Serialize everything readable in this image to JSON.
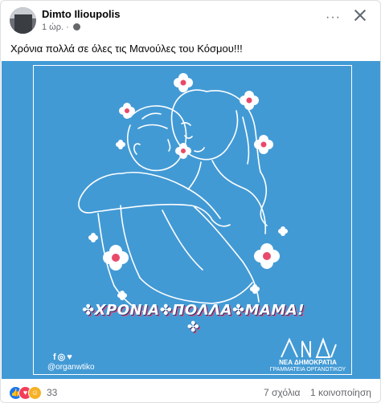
{
  "post": {
    "author": "Dimto Ilioupolis",
    "timestamp": "1 ώρ. ·",
    "privacy_icon": "globe-icon",
    "text": "Χρόνια πολλά σε όλες τις Μανούλες του Κόσμου!!!"
  },
  "header_actions": {
    "more_label": "···",
    "close_icon": "close-icon"
  },
  "image": {
    "background_color": "#429ad5",
    "banner_text": "✤ΧΡΟΝΙΑ✤ΠΟΛΛΑ✤ΜΑΜΑ! ✤",
    "social_icons": "f◎♥",
    "handle": "@organwtiko",
    "org_name": "ΝΕΑ ΔΗΜΟΚΡΑΤΙΑ",
    "org_sub": "ΓΡΑΜΜΑΤΕΙΑ ΟΡΓΑΝΩΤΙΚΟΥ"
  },
  "footer": {
    "reaction_icons": [
      "like-icon",
      "love-icon",
      "care-icon"
    ],
    "reaction_count": "33",
    "comments": "7 σχόλια",
    "shares": "1 κοινοποίηση"
  }
}
